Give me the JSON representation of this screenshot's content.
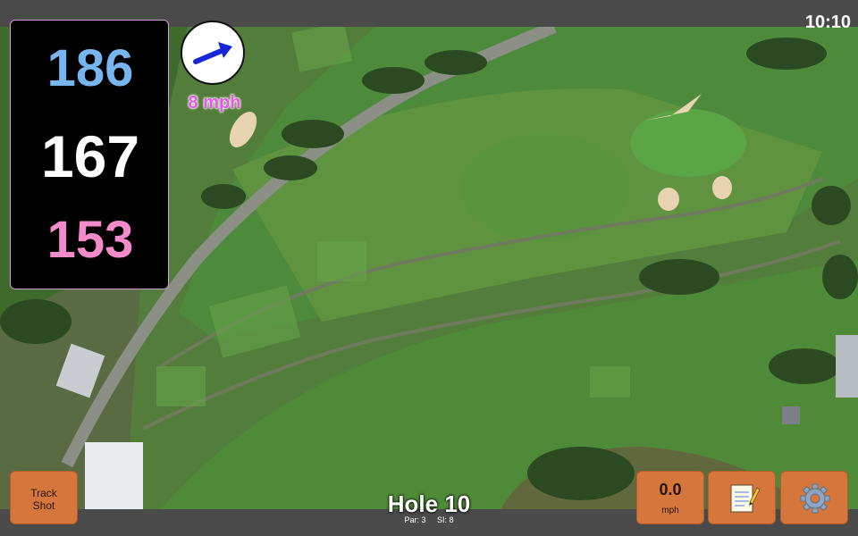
{
  "status": {
    "time": "10:10"
  },
  "distances": {
    "back": "186",
    "middle": "167",
    "front": "153"
  },
  "wind": {
    "label": "8 mph",
    "arrow_icon": "arrow-right-icon"
  },
  "buttons": {
    "track_shot_line1": "Track",
    "track_shot_line2": "Shot",
    "wind_value": "0.0",
    "wind_unit": "mph",
    "notes_icon": "notepad-icon",
    "settings_icon": "gear-icon"
  },
  "hole": {
    "title": "Hole 10",
    "par": "Par: 3",
    "stroke_index": "SI: 8"
  },
  "colors": {
    "back": "#78b4ee",
    "middle": "#ffffff",
    "front": "#f28bca",
    "wind": "#e35be3",
    "button": "#d5773d"
  }
}
